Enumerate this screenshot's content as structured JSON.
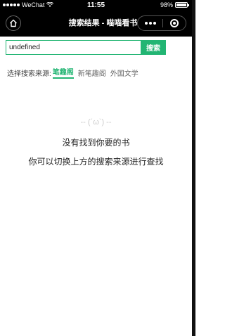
{
  "status_bar": {
    "carrier": "WeChat",
    "time": "11:55",
    "battery_text": "98%",
    "battery_level": 0.98,
    "wifi_icon": "wifi-icon"
  },
  "nav": {
    "title": "搜索结果 - 喵喵看书",
    "home_icon": "home-icon",
    "more_icon": "more-icon",
    "close_icon": "close-circle-icon"
  },
  "search": {
    "value": "undefined",
    "placeholder": "",
    "button_label": "搜索"
  },
  "source": {
    "label": "选择搜索来源:",
    "options": [
      "笔趣阁",
      "新笔趣阁",
      "外国文学"
    ],
    "active_index": 0
  },
  "empty_state": {
    "face": "-- (´ω`) --",
    "line1": "没有找到你要的书",
    "line2": "你可以切换上方的搜索来源进行查找"
  },
  "colors": {
    "accent": "#22b573",
    "bar_bg": "#000000"
  }
}
